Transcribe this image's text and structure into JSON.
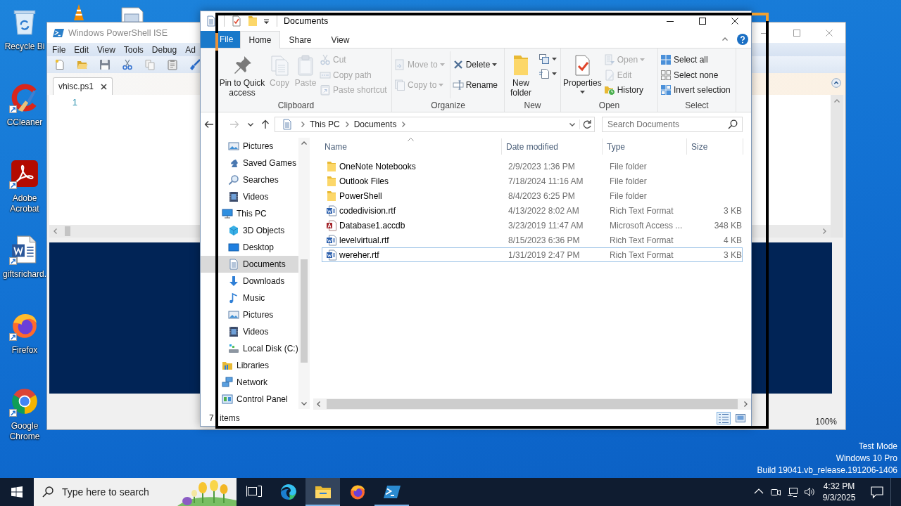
{
  "desktop": {
    "icons": [
      {
        "kind": "recycle",
        "label": "Recycle Bi",
        "shortcut": false
      },
      {
        "kind": "ccleaner",
        "label": "CCleaner",
        "shortcut": true
      },
      {
        "kind": "acrobat",
        "label": "Adobe Acrobat",
        "shortcut": true
      },
      {
        "kind": "document",
        "label": "giftsrichard.",
        "shortcut": true
      },
      {
        "kind": "firefox",
        "label": "Firefox",
        "shortcut": true
      },
      {
        "kind": "chrome",
        "label": "Google Chrome",
        "shortcut": true
      }
    ],
    "system_text": [
      "Test Mode",
      "Windows 10 Pro",
      "Build 19041.vb_release.191206-1406"
    ]
  },
  "powershell_ise": {
    "title": "Windows PowerShell ISE",
    "menu": [
      "File",
      "Edit",
      "View",
      "Tools",
      "Debug",
      "Ad"
    ],
    "tabs": [
      {
        "label": "vhisc.ps1",
        "selected": true
      }
    ],
    "line_numbers": [
      "1"
    ],
    "zoom": "100%"
  },
  "explorer": {
    "title": "Documents",
    "file_tab": "File",
    "tabs": [
      {
        "label": "Home",
        "selected": true
      },
      {
        "label": "Share",
        "selected": false
      },
      {
        "label": "View",
        "selected": false
      }
    ],
    "ribbon": [
      {
        "label": "Clipboard",
        "columns": [
          [
            {
              "kind": "large",
              "label": "Pin to Quick access",
              "disabled": false,
              "dropdown": false
            }
          ],
          [
            {
              "kind": "large",
              "label": "Copy",
              "disabled": true,
              "dropdown": false
            }
          ],
          [
            {
              "kind": "large",
              "label": "Paste",
              "disabled": true,
              "dropdown": false
            }
          ],
          [
            {
              "kind": "small",
              "label": "Cut",
              "disabled": true,
              "dropdown": false
            },
            {
              "kind": "small",
              "label": "Copy path",
              "disabled": true,
              "dropdown": false
            },
            {
              "kind": "small",
              "label": "Paste shortcut",
              "disabled": true,
              "dropdown": false
            }
          ]
        ]
      },
      {
        "label": "Organize",
        "columns": [
          [
            {
              "kind": "small",
              "label": "Move to",
              "disabled": true,
              "dropdown": true
            },
            {
              "kind": "small",
              "label": "Copy to",
              "disabled": true,
              "dropdown": true
            }
          ],
          [
            {
              "kind": "small",
              "label": "Delete",
              "disabled": false,
              "dropdown": true
            },
            {
              "kind": "small",
              "label": "Rename",
              "disabled": false,
              "dropdown": false
            }
          ]
        ]
      },
      {
        "label": "New",
        "columns": [
          [
            {
              "kind": "large",
              "label": "New folder",
              "disabled": false,
              "dropdown": false
            }
          ],
          [
            {
              "kind": "icon",
              "disabled": false,
              "dropdown": true
            },
            {
              "kind": "icon",
              "disabled": false,
              "dropdown": true
            }
          ]
        ]
      },
      {
        "label": "Open",
        "columns": [
          [
            {
              "kind": "large",
              "label": "Properties",
              "disabled": false,
              "dropdown": true
            }
          ],
          [
            {
              "kind": "small",
              "label": "Open",
              "disabled": true,
              "dropdown": true
            },
            {
              "kind": "small",
              "label": "Edit",
              "disabled": true,
              "dropdown": false
            },
            {
              "kind": "small",
              "label": "History",
              "disabled": false,
              "dropdown": false
            }
          ]
        ]
      },
      {
        "label": "Select",
        "columns": [
          [
            {
              "kind": "small",
              "label": "Select all",
              "disabled": false,
              "dropdown": false
            },
            {
              "kind": "small",
              "label": "Select none",
              "disabled": false,
              "dropdown": false
            },
            {
              "kind": "small",
              "label": "Invert selection",
              "disabled": false,
              "dropdown": false
            }
          ]
        ]
      }
    ],
    "nav_buttons": [
      {
        "kind": "back",
        "disabled": false
      },
      {
        "kind": "forward",
        "disabled": true
      },
      {
        "kind": "recent",
        "disabled": false
      },
      {
        "kind": "up",
        "disabled": false
      }
    ],
    "breadcrumbs": [
      "This PC",
      "Documents"
    ],
    "search_placeholder": "Search Documents",
    "nav_pane": {
      "continued_children": [
        {
          "kind": "pictures",
          "label": "Pictures",
          "selected": false
        },
        {
          "kind": "games",
          "label": "Saved Games",
          "selected": false
        },
        {
          "kind": "searches",
          "label": "Searches",
          "selected": false
        },
        {
          "kind": "videos",
          "label": "Videos",
          "selected": false
        }
      ],
      "items": [
        {
          "kind": "pc",
          "label": "This PC",
          "selected": false,
          "children": [
            {
              "kind": "objects",
              "label": "3D Objects",
              "selected": false
            },
            {
              "kind": "desktop",
              "label": "Desktop",
              "selected": false
            },
            {
              "kind": "documents",
              "label": "Documents",
              "selected": true
            },
            {
              "kind": "downloads",
              "label": "Downloads",
              "selected": false
            },
            {
              "kind": "music",
              "label": "Music",
              "selected": false
            },
            {
              "kind": "pictures",
              "label": "Pictures",
              "selected": false
            },
            {
              "kind": "videos",
              "label": "Videos",
              "selected": false
            },
            {
              "kind": "disk",
              "label": "Local Disk (C:)",
              "selected": false
            }
          ]
        },
        {
          "kind": "libraries",
          "label": "Libraries",
          "selected": false
        },
        {
          "kind": "network",
          "label": "Network",
          "selected": false
        },
        {
          "kind": "controlpanel",
          "label": "Control Panel",
          "selected": false
        }
      ]
    },
    "columns": [
      {
        "label": "Name",
        "sorted": true
      },
      {
        "label": "Date modified",
        "sorted": false
      },
      {
        "label": "Type",
        "sorted": false
      },
      {
        "label": "Size",
        "sorted": false
      }
    ],
    "files": [
      {
        "kind": "folder",
        "name": "OneNote Notebooks",
        "date": "2/9/2023 1:36 PM",
        "type": "File folder",
        "focused": false
      },
      {
        "kind": "folder",
        "name": "Outlook Files",
        "date": "7/18/2024 11:16 AM",
        "type": "File folder",
        "focused": false
      },
      {
        "kind": "folder",
        "name": "PowerShell",
        "date": "8/4/2023 6:25 PM",
        "type": "File folder",
        "focused": false
      },
      {
        "kind": "rtf",
        "name": "codedivision.rtf",
        "date": "4/13/2022 8:02 AM",
        "type": "Rich Text Format",
        "size": "3 KB",
        "focused": false
      },
      {
        "kind": "accdb",
        "name": "Database1.accdb",
        "date": "3/23/2019 11:47 AM",
        "type": "Microsoft Access ...",
        "size": "348 KB",
        "focused": false
      },
      {
        "kind": "rtf",
        "name": "levelvirtual.rtf",
        "date": "8/15/2023 6:36 PM",
        "type": "Rich Text Format",
        "size": "4 KB",
        "focused": false
      },
      {
        "kind": "rtf",
        "name": "wereher.rtf",
        "date": "1/31/2019 2:47 PM",
        "type": "Rich Text Format",
        "size": "3 KB",
        "focused": true
      }
    ],
    "status": "7 items",
    "views": [
      {
        "kind": "details",
        "selected": true
      },
      {
        "kind": "tiles",
        "selected": false
      }
    ]
  },
  "taskbar": {
    "search_placeholder": "Type here to search",
    "apps": [
      {
        "kind": "taskview",
        "running": false,
        "active": false
      },
      {
        "kind": "edge",
        "running": false,
        "active": false
      },
      {
        "kind": "explorer",
        "running": true,
        "active": true
      },
      {
        "kind": "firefox",
        "running": false,
        "active": false
      },
      {
        "kind": "powershell",
        "running": true,
        "active": false
      }
    ],
    "clock": {
      "time": "4:32 PM",
      "date": "9/3/2025"
    }
  }
}
